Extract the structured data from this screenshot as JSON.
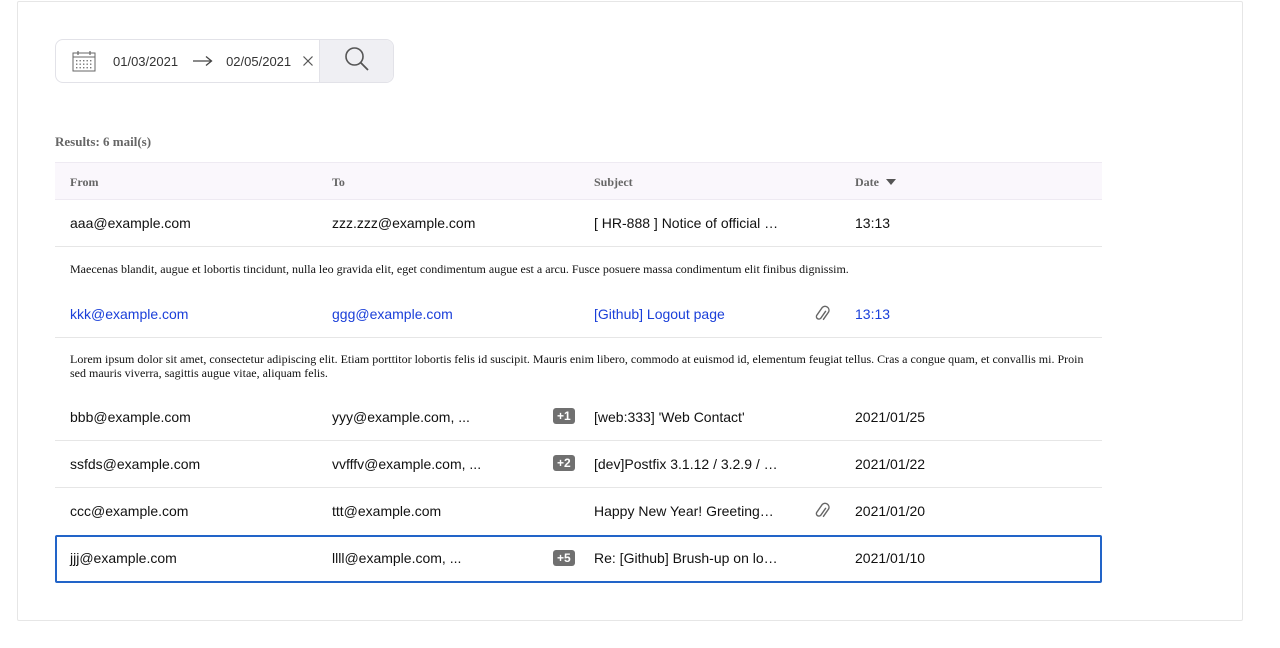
{
  "search": {
    "date_start": "01/03/2021",
    "date_end": "02/05/2021",
    "icons": [
      "calendar-icon",
      "arrow-right-icon",
      "close-icon",
      "search-icon"
    ]
  },
  "results": {
    "label": "Results: 6 mail(s)"
  },
  "table": {
    "headers": {
      "from": "From",
      "to": "To",
      "subject": "Subject",
      "date": "Date"
    },
    "sort_icon": "caret-down-icon",
    "rows": [
      {
        "from": "aaa@example.com",
        "to": "zzz.zzz@example.com",
        "badge": "",
        "subject": "[ HR-888 ] Notice of official a…",
        "attachment": false,
        "date": "13:13",
        "preview": "Maecenas blandit, augue et lobortis tincidunt, nulla leo gravida elit, eget condimentum augue est a arcu. Fusce posuere massa condimentum elit finibus dignissim."
      },
      {
        "from": "kkk@example.com",
        "to": "ggg@example.com",
        "badge": "",
        "subject": "[Github] Logout page",
        "attachment": true,
        "date": "13:13",
        "preview": "Lorem ipsum dolor sit amet, consectetur adipiscing elit. Etiam porttitor lobortis felis id suscipit. Mauris enim libero, commodo at euismod id, elementum feugiat tellus. Cras a congue quam, et convallis mi. Proin sed mauris viverra, sagittis augue vitae, aliquam felis."
      },
      {
        "from": "bbb@example.com",
        "to": "yyy@example.com, ...",
        "badge": "+1",
        "subject": "[web:333] 'Web Contact'",
        "attachment": false,
        "date": "2021/01/25"
      },
      {
        "from": "ssfds@example.com",
        "to": "vvfffv@example.com, ...",
        "badge": "+2",
        "subject": "[dev]Postfix 3.1.12 / 3.2.9 / 3.…",
        "attachment": false,
        "date": "2021/01/22"
      },
      {
        "from": "ccc@example.com",
        "to": "ttt@example.com",
        "badge": "",
        "subject": "Happy New Year! Greetings f…",
        "attachment": true,
        "date": "2021/01/20"
      },
      {
        "from": "jjj@example.com",
        "to": "llll@example.com, ...",
        "badge": "+5",
        "subject": "Re: [Github] Brush-up on loa…",
        "attachment": false,
        "date": "2021/01/10"
      }
    ]
  },
  "colors": {
    "unread_text": "#1a3fd9",
    "selected_border": "#2264c8",
    "header_bg": "#faf7fc",
    "badge_bg": "#707070"
  }
}
